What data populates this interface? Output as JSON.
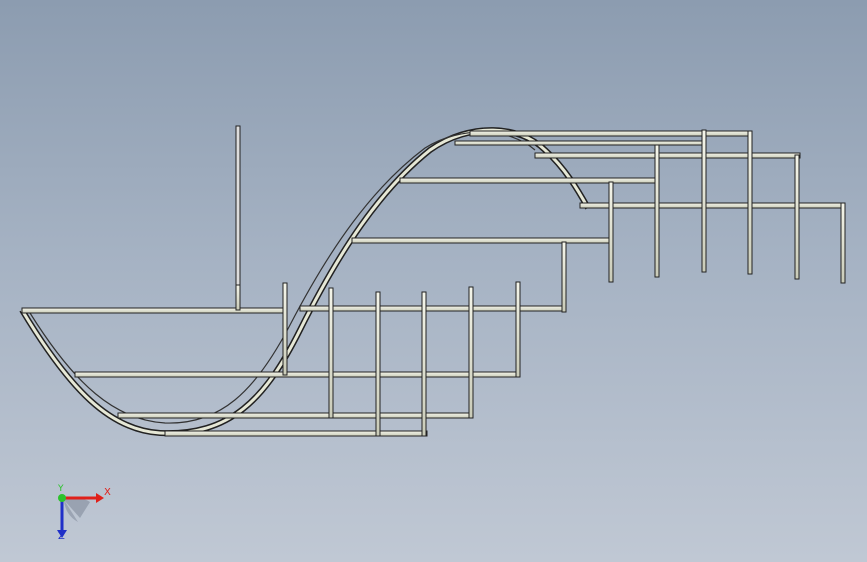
{
  "viewport": {
    "background_top": "#8c9cb0",
    "background_bottom": "#c0c8d4"
  },
  "model": {
    "description_icon": "tube-frame-assembly",
    "tube_color": "#e8ead8",
    "tube_outline": "#2a2a2a"
  },
  "triad": {
    "x_label": "X",
    "y_label": "Y",
    "z_label": "Z",
    "x_color": "#e0201a",
    "y_color": "#2cc22c",
    "z_color": "#2030c8"
  }
}
